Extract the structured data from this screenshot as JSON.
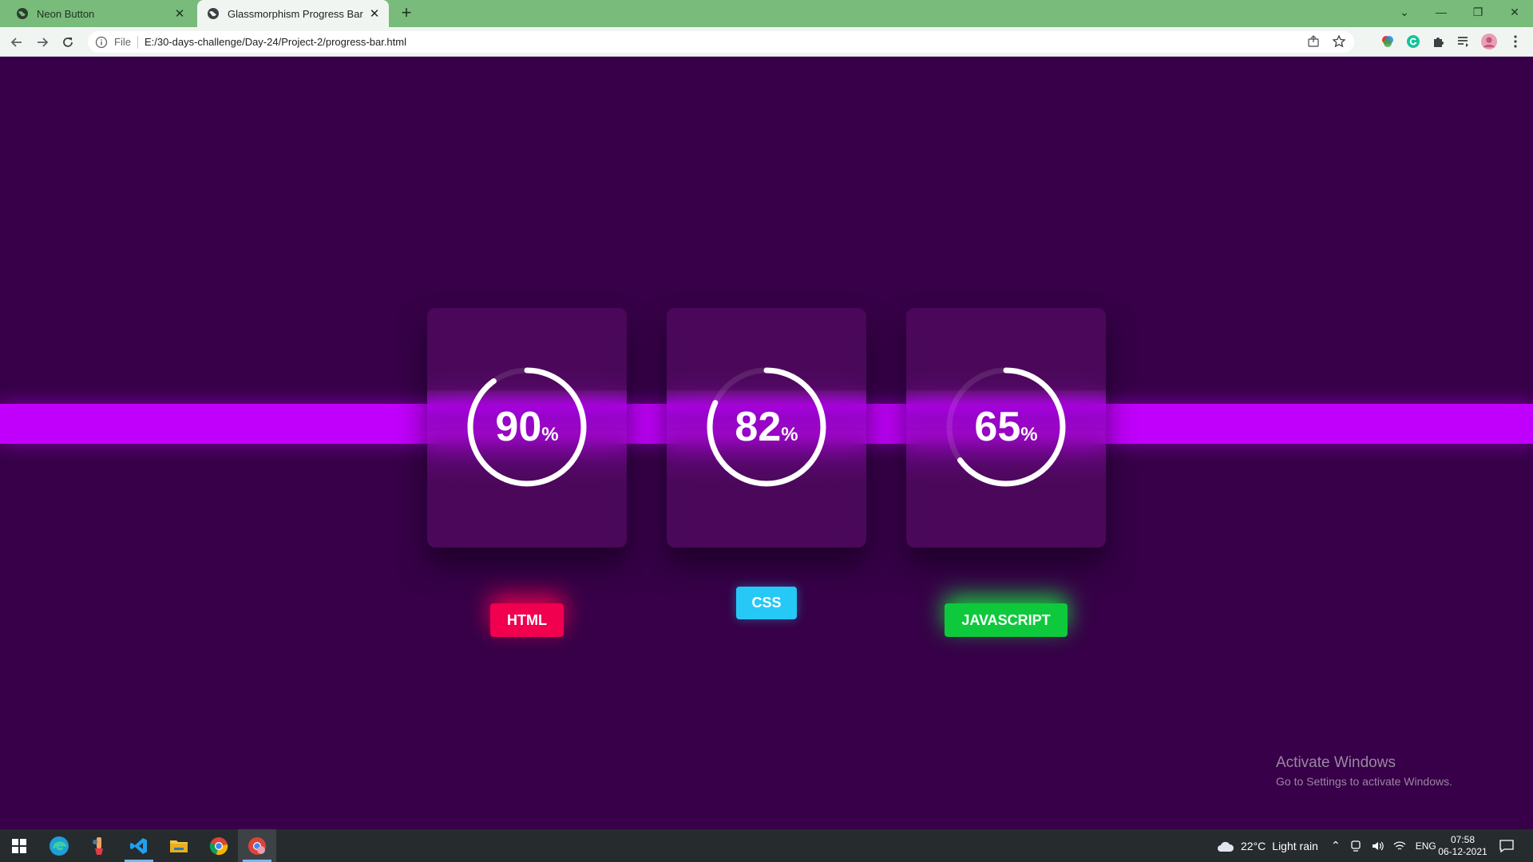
{
  "browser": {
    "tabs": [
      {
        "title": "Neon Button",
        "close": "✕",
        "active": false
      },
      {
        "title": "Glassmorphism Progress Bar",
        "close": "✕",
        "active": true
      }
    ],
    "new_tab": "+",
    "window_controls": {
      "menu": "⌄",
      "minimize": "—",
      "restore": "❐",
      "close": "✕"
    },
    "address": {
      "scheme": "File",
      "url": "E:/30-days-challenge/Day-24/Project-2/progress-bar.html"
    }
  },
  "page": {
    "skills": [
      {
        "value": "90",
        "unit": "%",
        "label": "HTML",
        "progress": 0.9,
        "color": "#f0004f"
      },
      {
        "value": "82",
        "unit": "%",
        "label": "CSS",
        "progress": 0.82,
        "color": "#26c8f5"
      },
      {
        "value": "65",
        "unit": "%",
        "label": "JAVASCRIPT",
        "progress": 0.65,
        "color": "#0ec93b"
      }
    ],
    "stripe_color": "#c000fa",
    "background_color": "#370048"
  },
  "watermark": {
    "title": "Activate Windows",
    "subtitle": "Go to Settings to activate Windows."
  },
  "taskbar": {
    "apps": [
      "windows-start",
      "edge",
      "paint-app",
      "vscode",
      "file-explorer",
      "chrome",
      "chrome-profile"
    ],
    "weather": {
      "temp": "22°C",
      "condition": "Light rain"
    },
    "language": "ENG",
    "time": "07:58",
    "date": "06-12-2021"
  }
}
